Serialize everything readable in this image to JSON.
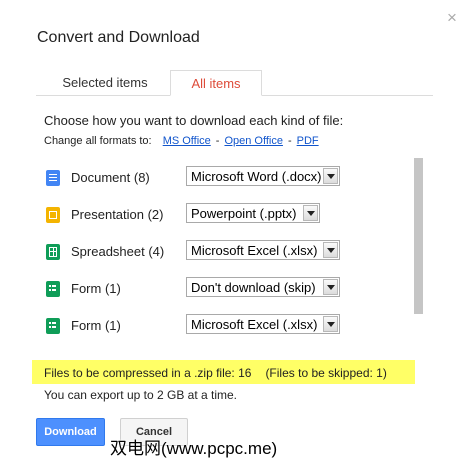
{
  "dialog": {
    "title": "Convert and Download",
    "close_glyph": "×"
  },
  "tabs": [
    {
      "label": "Selected items",
      "selected": false
    },
    {
      "label": "All items",
      "selected": true
    }
  ],
  "instructions": "Choose how you want to download each kind of file:",
  "change_all": {
    "label": "Change all formats to:",
    "options": [
      "MS Office",
      "Open Office",
      "PDF"
    ],
    "separator": "-"
  },
  "file_types": [
    {
      "icon": "document-icon",
      "label": "Document  (8)",
      "format": "Microsoft Word (.docx)"
    },
    {
      "icon": "presentation-icon",
      "label": "Presentation  (2)",
      "format": "Powerpoint (.pptx)"
    },
    {
      "icon": "spreadsheet-icon",
      "label": "Spreadsheet  (4)",
      "format": "Microsoft Excel (.xlsx)"
    },
    {
      "icon": "form-icon",
      "label": "Form  (1)",
      "format": "Don't download (skip)"
    },
    {
      "icon": "form-icon",
      "label": "Form  (1)",
      "format": "Microsoft Excel (.xlsx)"
    }
  ],
  "summary": {
    "compressed": "Files to be compressed in a .zip file: 16",
    "skipped": "(Files to be skipped: 1)",
    "export_limit": "You can export up to 2 GB at a time."
  },
  "buttons": {
    "download": "Download",
    "cancel": "Cancel"
  },
  "watermark": "双电网(www.pcpc.me)",
  "colors": {
    "accent_red": "#dd4b39",
    "link_blue": "#1155cc",
    "primary_button": "#4d90fe",
    "highlight": "#ffff66",
    "doc_icon": "#4285f4",
    "pres_icon": "#f4b400",
    "sheet_icon": "#0f9d58"
  }
}
